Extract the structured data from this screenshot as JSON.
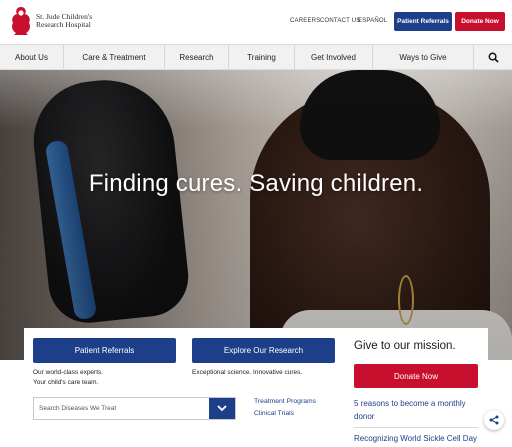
{
  "header": {
    "logo_line1": "St. Jude Children's",
    "logo_line2": "Research Hospital",
    "utility_links": [
      "CAREERS",
      "CONTACT US",
      "ESPAÑOL"
    ],
    "patient_referrals_label": "Patient Referrals",
    "donate_label": "Donate Now"
  },
  "nav": {
    "items": [
      "About Us",
      "Care & Treatment",
      "Research",
      "Training",
      "Get Involved",
      "Ways to Give"
    ],
    "search_icon": "search-icon"
  },
  "hero": {
    "title": "Finding cures. Saving children."
  },
  "content": {
    "patient_referrals_button": "Patient Referrals",
    "explore_research_button": "Explore Our Research",
    "patient_desc_line1": "Our world-class experts.",
    "patient_desc_line2": "Your child's care team.",
    "research_desc": "Exceptional science. Innovative cures.",
    "search_placeholder": "Search Diseases We Treat",
    "links": [
      "Treatment Programs",
      "Clinical Trials"
    ]
  },
  "sidebar": {
    "title": "Give to our mission.",
    "donate_label": "Donate Now",
    "links": [
      "5 reasons to become a monthly donor",
      "Recognizing World Sickle Cell Day"
    ]
  },
  "colors": {
    "brand_blue": "#1d3f8a",
    "brand_red": "#c8102e"
  }
}
